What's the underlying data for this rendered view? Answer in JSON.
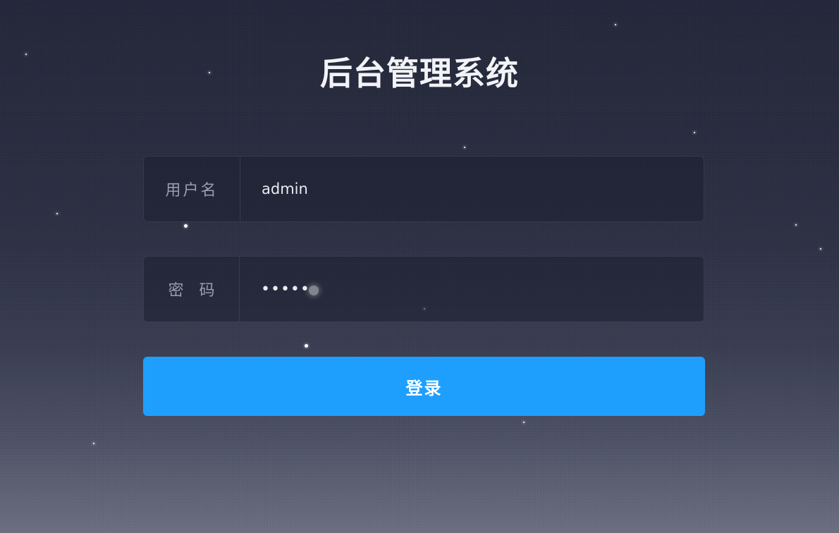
{
  "title": "后台管理系统",
  "form": {
    "username": {
      "label": "用户名",
      "value": "admin"
    },
    "password": {
      "label": "密码",
      "value": "•••••"
    },
    "submit_label": "登录"
  },
  "colors": {
    "primary_button": "#1e9ffe",
    "background_top": "#222639",
    "background_bottom": "#6a6e80"
  }
}
